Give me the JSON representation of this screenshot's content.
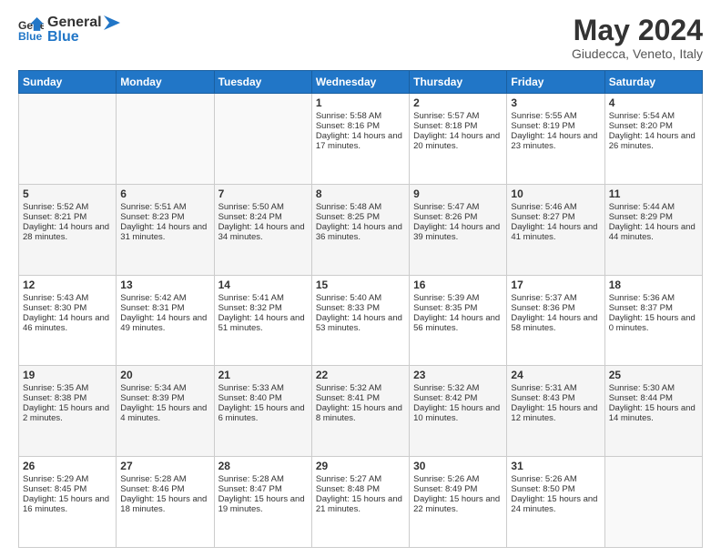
{
  "header": {
    "logo_line1": "General",
    "logo_line2": "Blue",
    "month": "May 2024",
    "location": "Giudecca, Veneto, Italy"
  },
  "days_of_week": [
    "Sunday",
    "Monday",
    "Tuesday",
    "Wednesday",
    "Thursday",
    "Friday",
    "Saturday"
  ],
  "weeks": [
    [
      {
        "day": "",
        "text": ""
      },
      {
        "day": "",
        "text": ""
      },
      {
        "day": "",
        "text": ""
      },
      {
        "day": "1",
        "text": "Sunrise: 5:58 AM\nSunset: 8:16 PM\nDaylight: 14 hours and 17 minutes."
      },
      {
        "day": "2",
        "text": "Sunrise: 5:57 AM\nSunset: 8:18 PM\nDaylight: 14 hours and 20 minutes."
      },
      {
        "day": "3",
        "text": "Sunrise: 5:55 AM\nSunset: 8:19 PM\nDaylight: 14 hours and 23 minutes."
      },
      {
        "day": "4",
        "text": "Sunrise: 5:54 AM\nSunset: 8:20 PM\nDaylight: 14 hours and 26 minutes."
      }
    ],
    [
      {
        "day": "5",
        "text": "Sunrise: 5:52 AM\nSunset: 8:21 PM\nDaylight: 14 hours and 28 minutes."
      },
      {
        "day": "6",
        "text": "Sunrise: 5:51 AM\nSunset: 8:23 PM\nDaylight: 14 hours and 31 minutes."
      },
      {
        "day": "7",
        "text": "Sunrise: 5:50 AM\nSunset: 8:24 PM\nDaylight: 14 hours and 34 minutes."
      },
      {
        "day": "8",
        "text": "Sunrise: 5:48 AM\nSunset: 8:25 PM\nDaylight: 14 hours and 36 minutes."
      },
      {
        "day": "9",
        "text": "Sunrise: 5:47 AM\nSunset: 8:26 PM\nDaylight: 14 hours and 39 minutes."
      },
      {
        "day": "10",
        "text": "Sunrise: 5:46 AM\nSunset: 8:27 PM\nDaylight: 14 hours and 41 minutes."
      },
      {
        "day": "11",
        "text": "Sunrise: 5:44 AM\nSunset: 8:29 PM\nDaylight: 14 hours and 44 minutes."
      }
    ],
    [
      {
        "day": "12",
        "text": "Sunrise: 5:43 AM\nSunset: 8:30 PM\nDaylight: 14 hours and 46 minutes."
      },
      {
        "day": "13",
        "text": "Sunrise: 5:42 AM\nSunset: 8:31 PM\nDaylight: 14 hours and 49 minutes."
      },
      {
        "day": "14",
        "text": "Sunrise: 5:41 AM\nSunset: 8:32 PM\nDaylight: 14 hours and 51 minutes."
      },
      {
        "day": "15",
        "text": "Sunrise: 5:40 AM\nSunset: 8:33 PM\nDaylight: 14 hours and 53 minutes."
      },
      {
        "day": "16",
        "text": "Sunrise: 5:39 AM\nSunset: 8:35 PM\nDaylight: 14 hours and 56 minutes."
      },
      {
        "day": "17",
        "text": "Sunrise: 5:37 AM\nSunset: 8:36 PM\nDaylight: 14 hours and 58 minutes."
      },
      {
        "day": "18",
        "text": "Sunrise: 5:36 AM\nSunset: 8:37 PM\nDaylight: 15 hours and 0 minutes."
      }
    ],
    [
      {
        "day": "19",
        "text": "Sunrise: 5:35 AM\nSunset: 8:38 PM\nDaylight: 15 hours and 2 minutes."
      },
      {
        "day": "20",
        "text": "Sunrise: 5:34 AM\nSunset: 8:39 PM\nDaylight: 15 hours and 4 minutes."
      },
      {
        "day": "21",
        "text": "Sunrise: 5:33 AM\nSunset: 8:40 PM\nDaylight: 15 hours and 6 minutes."
      },
      {
        "day": "22",
        "text": "Sunrise: 5:32 AM\nSunset: 8:41 PM\nDaylight: 15 hours and 8 minutes."
      },
      {
        "day": "23",
        "text": "Sunrise: 5:32 AM\nSunset: 8:42 PM\nDaylight: 15 hours and 10 minutes."
      },
      {
        "day": "24",
        "text": "Sunrise: 5:31 AM\nSunset: 8:43 PM\nDaylight: 15 hours and 12 minutes."
      },
      {
        "day": "25",
        "text": "Sunrise: 5:30 AM\nSunset: 8:44 PM\nDaylight: 15 hours and 14 minutes."
      }
    ],
    [
      {
        "day": "26",
        "text": "Sunrise: 5:29 AM\nSunset: 8:45 PM\nDaylight: 15 hours and 16 minutes."
      },
      {
        "day": "27",
        "text": "Sunrise: 5:28 AM\nSunset: 8:46 PM\nDaylight: 15 hours and 18 minutes."
      },
      {
        "day": "28",
        "text": "Sunrise: 5:28 AM\nSunset: 8:47 PM\nDaylight: 15 hours and 19 minutes."
      },
      {
        "day": "29",
        "text": "Sunrise: 5:27 AM\nSunset: 8:48 PM\nDaylight: 15 hours and 21 minutes."
      },
      {
        "day": "30",
        "text": "Sunrise: 5:26 AM\nSunset: 8:49 PM\nDaylight: 15 hours and 22 minutes."
      },
      {
        "day": "31",
        "text": "Sunrise: 5:26 AM\nSunset: 8:50 PM\nDaylight: 15 hours and 24 minutes."
      },
      {
        "day": "",
        "text": ""
      }
    ]
  ]
}
